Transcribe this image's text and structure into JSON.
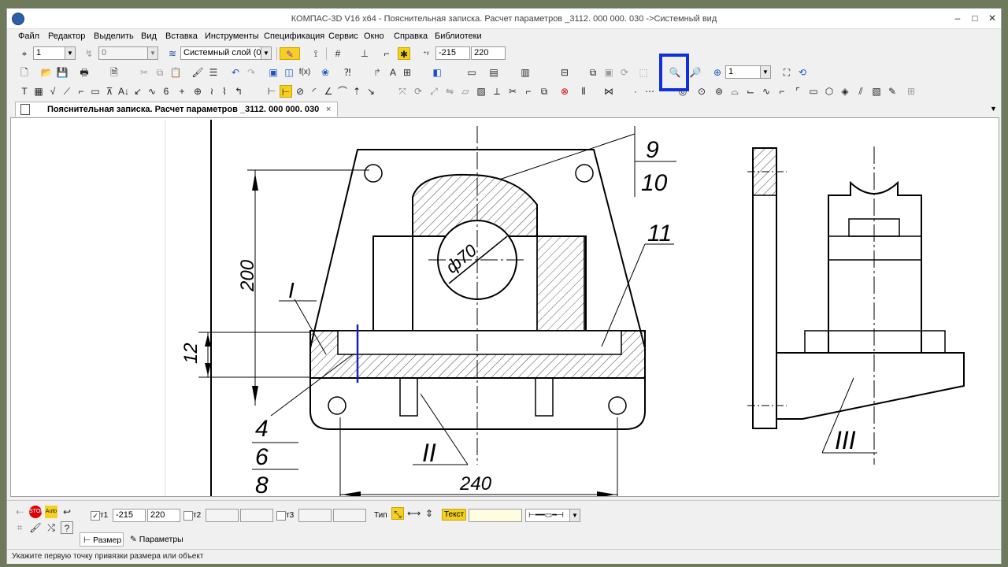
{
  "window": {
    "title": "КОМПАС-3D V16  x64 - Пояснительная записка. Расчет параметров _3112. 000 000. 030 ->Системный вид",
    "min": "–",
    "max": "□",
    "close": "✕"
  },
  "menu": [
    "Файл",
    "Редактор",
    "Выделить",
    "Вид",
    "Вставка",
    "Инструменты",
    "Спецификация",
    "Сервис",
    "Окно",
    "Справка",
    "Библиотеки"
  ],
  "toolbar1": {
    "view_number": "1",
    "layer_number": "0",
    "layer_name": "Системный слой (0)",
    "x_value": "-215",
    "y_value": "220"
  },
  "toolbar2": {
    "zoom_value": "1"
  },
  "document_tab": {
    "label": "Пояснительная записка. Расчет параметров _3112. 000 000. 030",
    "close": "×"
  },
  "drawing": {
    "dim_200": "200",
    "dim_12": "12",
    "dim_240": "240",
    "dim_phi70": "ф70",
    "callout_I": "I",
    "callout_II": "II",
    "callout_III": "III",
    "callout_4": "4",
    "callout_6": "6",
    "callout_8": "8",
    "callout_9": "9",
    "callout_10": "10",
    "callout_11": "11"
  },
  "properties": {
    "t1_label": "т1",
    "t1_x": "-215",
    "t1_y": "220",
    "t2_label": "т2",
    "t3_label": "т3",
    "type_label": "Тип",
    "text_label": "Текст",
    "tab_size": "Размер",
    "tab_params": "Параметры"
  },
  "status": {
    "hint": "Укажите первую точку привязки размера или объект"
  },
  "colors": {
    "highlight": "#1030d8",
    "accent_yellow": "#f5d020"
  }
}
